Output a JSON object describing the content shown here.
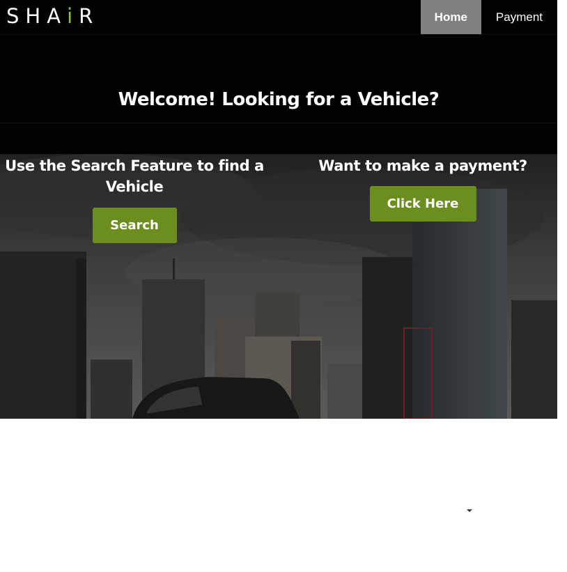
{
  "header": {
    "brand": {
      "prefix": "SHA",
      "accent": "i",
      "suffix": "R"
    },
    "nav": [
      {
        "label": "Home",
        "active": true
      },
      {
        "label": "Payment",
        "active": false
      }
    ]
  },
  "welcome": {
    "title": "Welcome! Looking for a Vehicle?"
  },
  "hero": {
    "search": {
      "heading": "Use the Search Feature to find a Vehicle",
      "button_label": "Search"
    },
    "payment": {
      "heading": "Want to make a payment?",
      "button_label": "Click Here"
    }
  },
  "colors": {
    "background_dark": "#000000",
    "nav_active": "#808080",
    "button_green": "#6b8e1e",
    "brand_accent": "#8dc63f"
  },
  "icons": [
    "caret-down-icon"
  ]
}
